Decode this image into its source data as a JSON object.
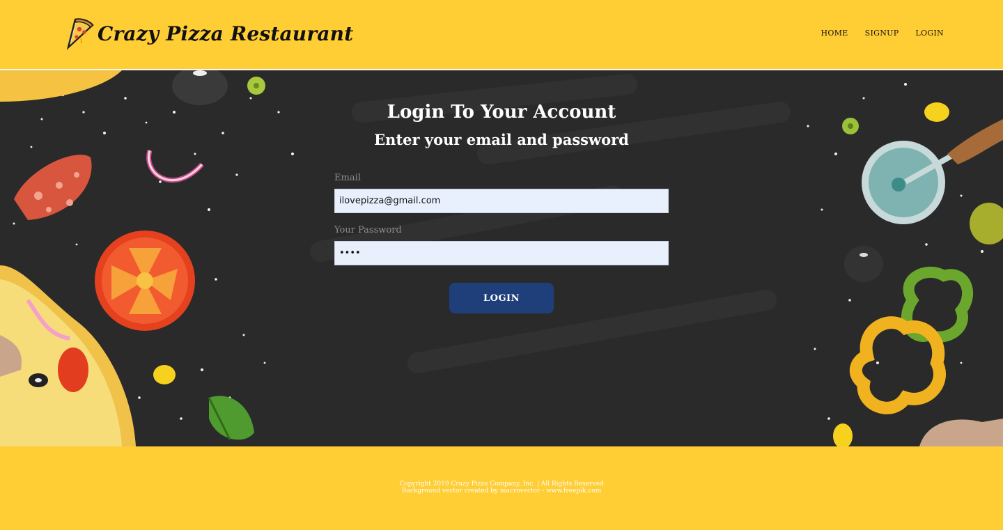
{
  "header": {
    "brand_title": "Crazy Pizza Restaurant",
    "logo_icon": "pizza-slice-icon",
    "nav": [
      {
        "label": "HOME"
      },
      {
        "label": "SIGNUP"
      },
      {
        "label": "LOGIN"
      }
    ]
  },
  "login": {
    "heading": "Login To Your Account",
    "subheading": "Enter your email and password",
    "email_label": "Email",
    "email_value": "ilovepizza@gmail.com",
    "password_label": "Your Password",
    "password_value": "pass",
    "button_label": "LOGIN"
  },
  "footer": {
    "copyright": "Copyright 2019 Crazy Pizza Company, Inc. | All Rights Reserved",
    "credit": "Background vector created by macrovector - www.freepik.com"
  },
  "colors": {
    "header_bg": "#FFCD34",
    "hero_bg": "#2a2a2a",
    "button_bg": "#1E3F7A",
    "input_bg": "#E8F0FE"
  }
}
